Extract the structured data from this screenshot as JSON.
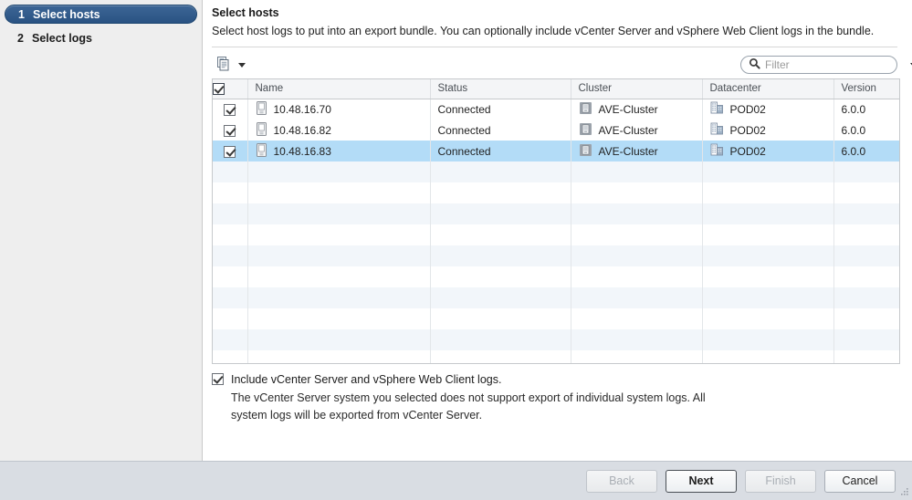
{
  "wizard": {
    "steps": [
      {
        "num": "1",
        "label": "Select hosts",
        "active": true
      },
      {
        "num": "2",
        "label": "Select logs",
        "active": false
      }
    ]
  },
  "header": {
    "title": "Select hosts",
    "description": "Select host logs to put into an export bundle. You can optionally include vCenter Server and vSphere Web Client logs in the bundle."
  },
  "toolbar": {
    "copy_icon": "copy-pages-icon",
    "copy_dropdown_icon": "caret-down-icon",
    "search_icon": "search-icon",
    "filter_placeholder": "Filter",
    "filter_value": "",
    "filter_dropdown_icon": "caret-down-icon"
  },
  "table": {
    "select_all_checked": true,
    "columns": [
      "Name",
      "Status",
      "Cluster",
      "Datacenter",
      "Version"
    ],
    "rows": [
      {
        "checked": true,
        "name": "10.48.16.70",
        "status": "Connected",
        "cluster": "AVE-Cluster",
        "datacenter": "POD02",
        "version": "6.0.0",
        "selected": false
      },
      {
        "checked": true,
        "name": "10.48.16.82",
        "status": "Connected",
        "cluster": "AVE-Cluster",
        "datacenter": "POD02",
        "version": "6.0.0",
        "selected": false
      },
      {
        "checked": true,
        "name": "10.48.16.83",
        "status": "Connected",
        "cluster": "AVE-Cluster",
        "datacenter": "POD02",
        "version": "6.0.0",
        "selected": true
      }
    ],
    "empty_row_count": 11,
    "host_icon": "host-server-icon",
    "cluster_icon": "cluster-icon",
    "datacenter_icon": "datacenter-building-icon"
  },
  "include": {
    "checked": true,
    "label": "Include vCenter Server and vSphere Web Client logs.",
    "note": "The vCenter Server system you selected does not support export of individual system logs. All system logs will be exported from vCenter Server."
  },
  "footer": {
    "buttons": [
      {
        "label": "Back",
        "state": "disabled"
      },
      {
        "label": "Next",
        "state": "default"
      },
      {
        "label": "Finish",
        "state": "disabled"
      },
      {
        "label": "Cancel",
        "state": "normal"
      }
    ]
  },
  "colors": {
    "accent": "#2a5383",
    "row_selected": "#b3dcf7",
    "footer_bg": "#d9dde3",
    "pane_bg": "#eeeeee"
  }
}
